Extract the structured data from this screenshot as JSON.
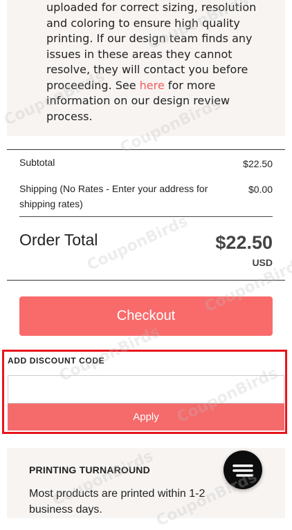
{
  "info": {
    "text_before_link": "uploaded for correct sizing, resolution and coloring to ensure high quality printing. If our design team finds any issues in these areas they cannot resolve, they will contact you before proceeding. See ",
    "link_text": "here",
    "text_after_link": " for more information on our design review process."
  },
  "summary": {
    "subtotal_label": "Subtotal",
    "subtotal_value": "$22.50",
    "shipping_label": "Shipping (No Rates - Enter your address for shipping rates)",
    "shipping_value": "$0.00",
    "total_label": "Order Total",
    "total_value": "$22.50",
    "total_currency": "USD"
  },
  "checkout": {
    "label": "Checkout"
  },
  "discount": {
    "label": "ADD DISCOUNT CODE",
    "input_value": "",
    "input_placeholder": "",
    "apply_label": "Apply"
  },
  "turnaround": {
    "title": "PRINTING TURNAROUND",
    "text": "Most products are printed within 1-2 business days."
  },
  "chat": {
    "icon": "chat-icon"
  },
  "watermark_text": "CouponBirds",
  "colors": {
    "accent": "#f96b6b",
    "link": "#f05d5e",
    "highlight_border": "#e8151c",
    "panel_bg": "#f7f4f2"
  }
}
